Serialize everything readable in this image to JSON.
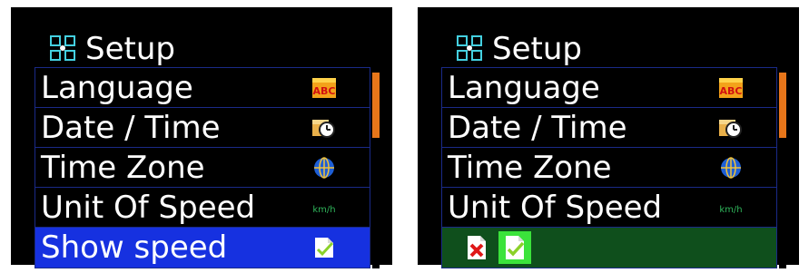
{
  "screens": [
    {
      "title": "Setup",
      "items": [
        {
          "label": "Language",
          "icon": "abc-language-icon",
          "icon_text": "ABC"
        },
        {
          "label": "Date / Time",
          "icon": "calendar-clock-icon"
        },
        {
          "label": "Time Zone",
          "icon": "globe-icon"
        },
        {
          "label": "Unit Of Speed",
          "icon": "kmh-icon",
          "icon_text": "km/h"
        },
        {
          "label": "Show speed",
          "icon": "checked-document-icon",
          "selected": true
        }
      ]
    },
    {
      "title": "Setup",
      "items": [
        {
          "label": "Language",
          "icon": "abc-language-icon",
          "icon_text": "ABC"
        },
        {
          "label": "Date / Time",
          "icon": "calendar-clock-icon"
        },
        {
          "label": "Time Zone",
          "icon": "globe-icon"
        },
        {
          "label": "Unit Of Speed",
          "icon": "kmh-icon",
          "icon_text": "km/h"
        }
      ],
      "options": [
        {
          "icon": "disabled-x-document-icon",
          "selected": false
        },
        {
          "icon": "enabled-check-document-icon",
          "selected": true
        }
      ]
    }
  ],
  "colors": {
    "background": "#000000",
    "selection": "#1631e0",
    "option_row": "#0f4f1c",
    "option_highlight": "#3be33b",
    "scrollbar": "#e8761a",
    "grid_line": "#1a2a88"
  }
}
